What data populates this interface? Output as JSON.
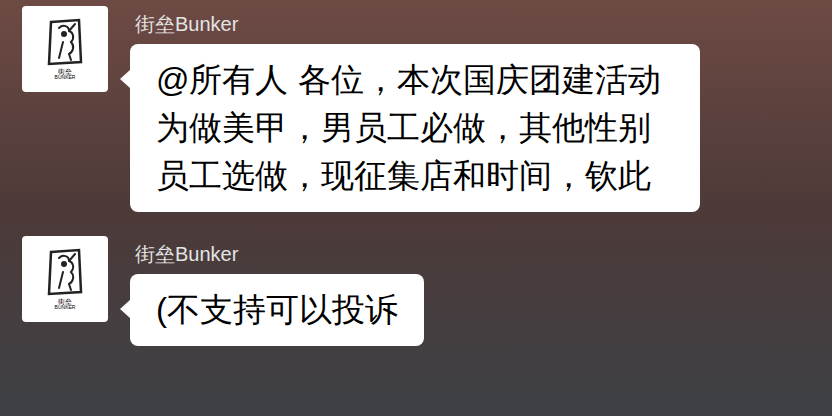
{
  "messages": [
    {
      "sender": "街垒Bunker",
      "avatar": {
        "logo_text": "街垒",
        "logo_subtext": "BUNKER"
      },
      "text": "@所有人 各位，本次国庆团建活动为做美甲，男员工必做，其他性别员工选做，现征集店和时间，钦此"
    },
    {
      "sender": "街垒Bunker",
      "avatar": {
        "logo_text": "街垒",
        "logo_subtext": "BUNKER"
      },
      "text": "(不支持可以投诉"
    }
  ]
}
